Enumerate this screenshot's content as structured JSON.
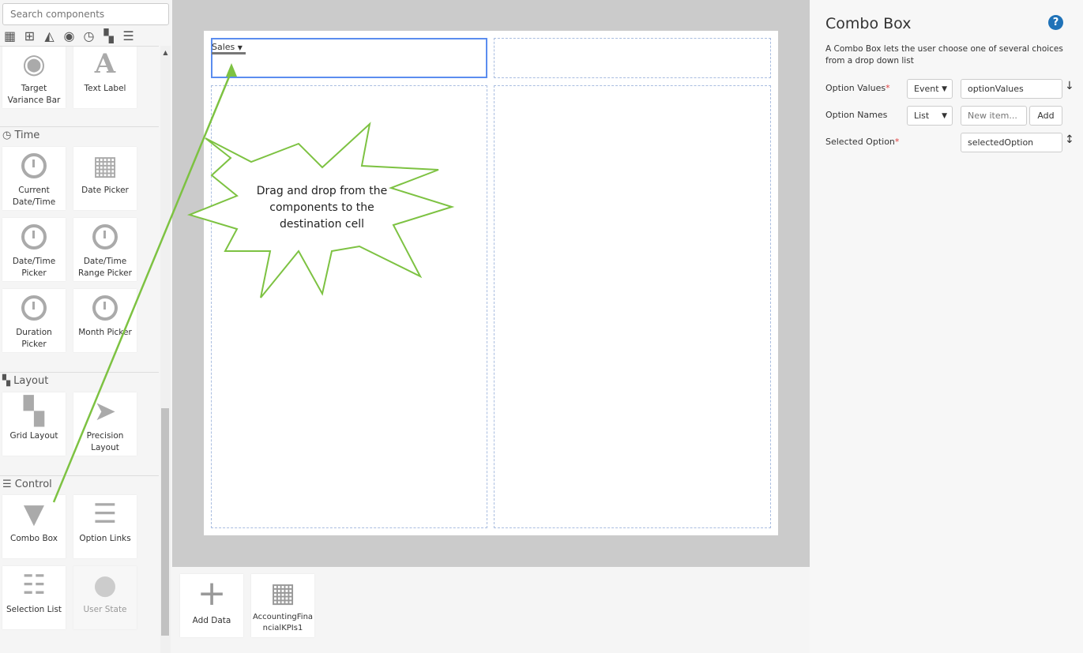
{
  "sidebar": {
    "search_placeholder": "Search components",
    "category_icons": [
      "table-icon",
      "hierarchy-icon",
      "area-chart-icon",
      "eye-icon",
      "clock-icon",
      "grid-icon",
      "sliders-icon"
    ],
    "sections": [
      {
        "title": "Time"
      },
      {
        "title": "Layout"
      },
      {
        "title": "Control"
      }
    ],
    "tiles": {
      "target_variance": "Target Variance Bar",
      "text_label": "Text Label",
      "current_datetime": "Current Date/Time",
      "date_picker": "Date Picker",
      "datetime_picker": "Date/Time Picker",
      "datetime_range": "Date/Time Range Picker",
      "duration_picker": "Duration Picker",
      "month_picker": "Month Picker",
      "grid_layout": "Grid Layout",
      "precision_layout": "Precision Layout",
      "combo_box": "Combo Box",
      "option_links": "Option Links",
      "selection_list": "Selection List",
      "user_state": "User State"
    }
  },
  "canvas": {
    "combo_value": "Sales",
    "callout": "Drag and drop from the components to the destination cell"
  },
  "bottom": {
    "add_data": "Add Data",
    "dataset": "AccountingFinancialKPIs1"
  },
  "panel": {
    "title": "Combo Box",
    "description": "A Combo Box lets the user choose one of several choices from a drop down list",
    "option_values_label": "Option Values",
    "option_values_type": "Event",
    "option_values_value": "optionValues",
    "option_names_label": "Option Names",
    "option_names_type": "List",
    "new_item_placeholder": "New item...",
    "add_label": "Add",
    "selected_option_label": "Selected Option",
    "selected_option_value": "selectedOption",
    "required_mark": "*"
  },
  "colors": {
    "accent": "#5b8def",
    "arrow": "#7dc242",
    "help": "#1f72b8"
  }
}
